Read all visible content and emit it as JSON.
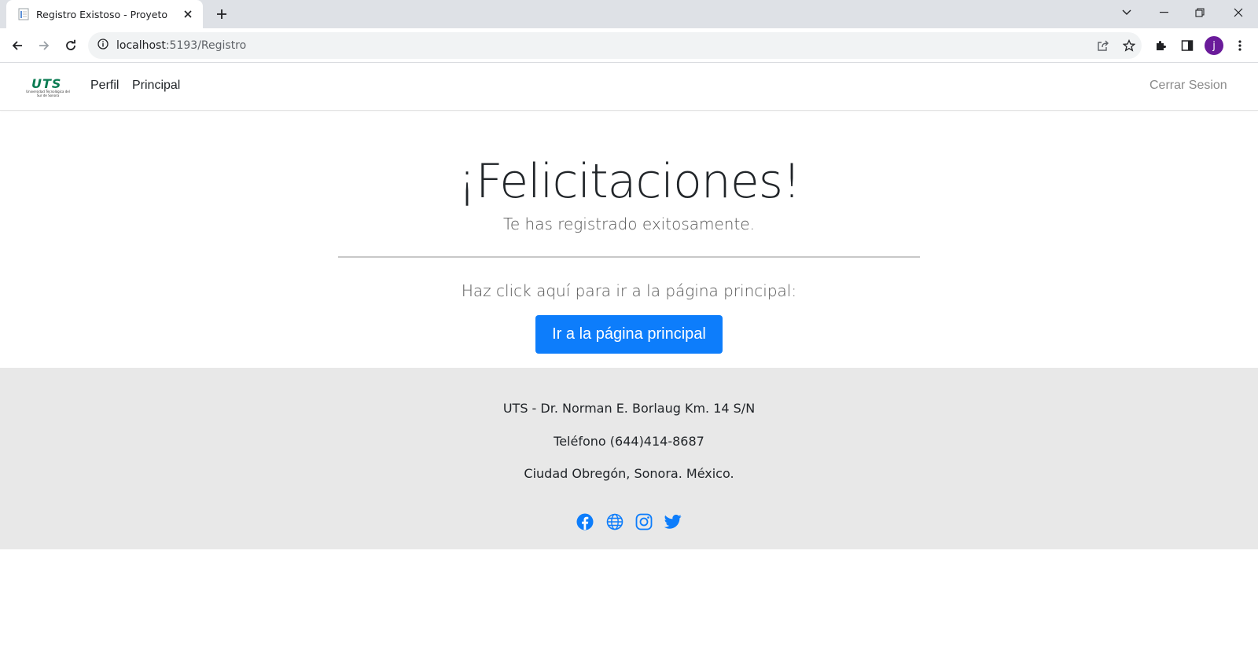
{
  "browser": {
    "tab_title": "Registro Existoso - Proyeto",
    "url_host": "localhost",
    "url_rest": ":5193/Registro",
    "profile_initial": "j"
  },
  "nav": {
    "logo_letters": "UTS",
    "logo_subtitle": "Universidad Tecnológica del Sur de Sonora",
    "links": [
      "Perfil",
      "Principal"
    ],
    "logout": "Cerrar Sesion"
  },
  "main": {
    "headline": "¡Felicitaciones!",
    "subheadline": "Te has registrado exitosamente.",
    "prompt": "Haz click aquí para ir a la página principal:",
    "button_label": "Ir a la página principal"
  },
  "footer": {
    "address": "UTS - Dr. Norman E. Borlaug Km. 14 S/N",
    "phone": "Teléfono (644)414-8687",
    "city": "Ciudad Obregón, Sonora. México.",
    "social_icons": [
      "facebook-icon",
      "globe-icon",
      "instagram-icon",
      "twitter-icon"
    ]
  },
  "colors": {
    "accent": "#0d7dfb",
    "logo": "#0a7b52",
    "footer_bg": "#e8e8e8"
  }
}
